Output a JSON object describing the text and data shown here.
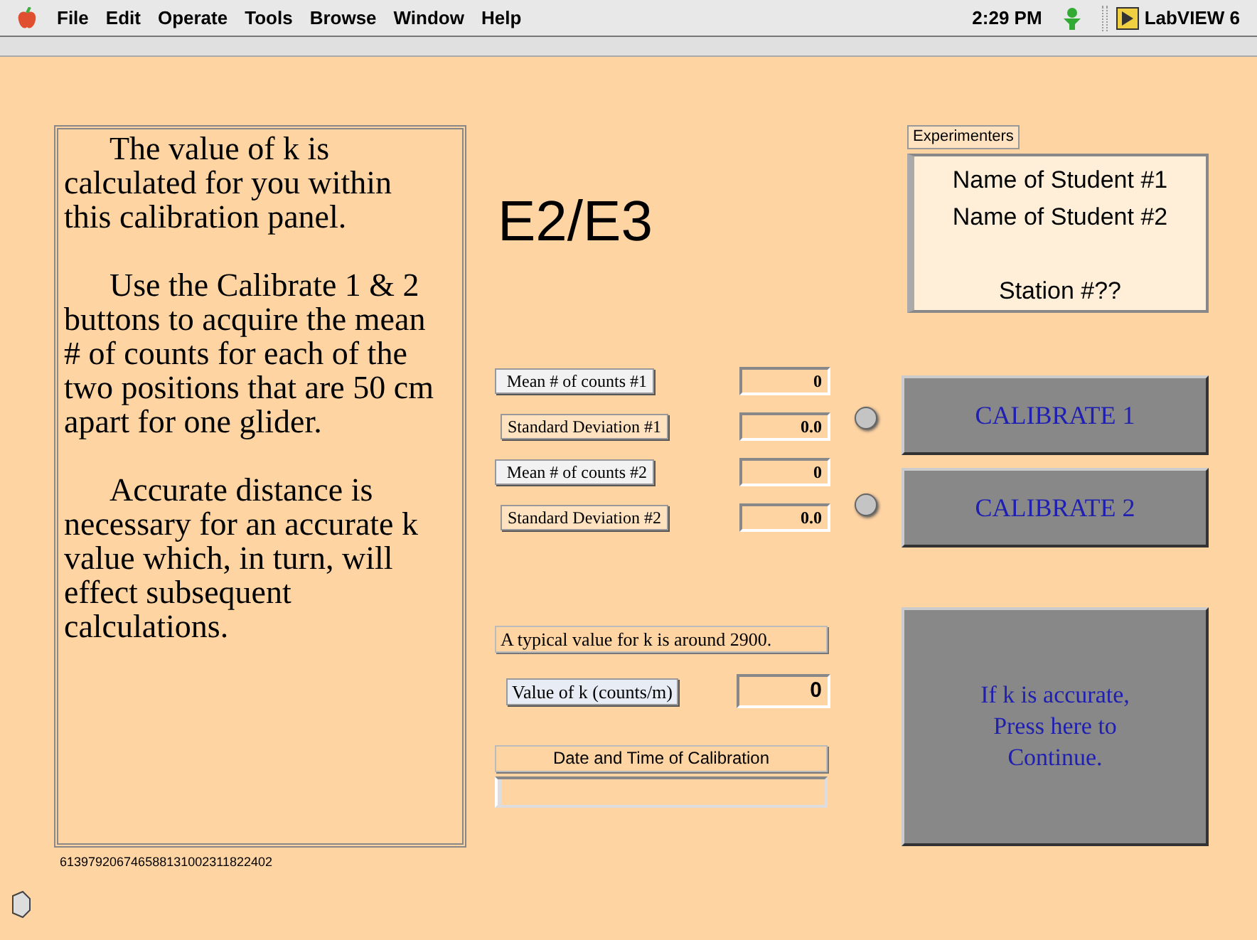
{
  "menu_bar": {
    "items": [
      "File",
      "Edit",
      "Operate",
      "Tools",
      "Browse",
      "Window",
      "Help"
    ],
    "time": "2:29 PM",
    "app": "LabVIEW 6"
  },
  "instructions": {
    "paragraphs": [
      "The value of k is calculated for you within this calibration panel.",
      "Use the Calibrate 1 & 2 buttons to acquire the mean # of counts for each of the two positions that are 50 cm apart for one glider.",
      "Accurate distance is necessary for an accurate k value which, in turn, will effect subsequent calculations."
    ]
  },
  "serial": "613979206746588131002311822402",
  "title": "E2/E3",
  "measurements": [
    {
      "label": "Mean # of counts #1",
      "value": "0"
    },
    {
      "label": "Standard Deviation #1",
      "value": "0.0"
    },
    {
      "label": "Mean # of counts #2",
      "value": "0"
    },
    {
      "label": "Standard Deviation #2",
      "value": "0.0"
    }
  ],
  "indicators": [
    {
      "on": false
    },
    {
      "on": false
    }
  ],
  "calibrate_buttons": [
    "CALIBRATE 1",
    "CALIBRATE 2"
  ],
  "typical_note": "A typical value for k is around 2900.",
  "k_value": {
    "label": "Value of k (counts/m)",
    "value": "0"
  },
  "calibration_time": {
    "label": "Date and Time of Calibration"
  },
  "experimenters": {
    "label": "Experimenters",
    "lines": [
      "Name of Student #1",
      "Name of Student #2",
      "Station #??"
    ]
  },
  "continue_button": "If k is accurate, Press here to Continue."
}
